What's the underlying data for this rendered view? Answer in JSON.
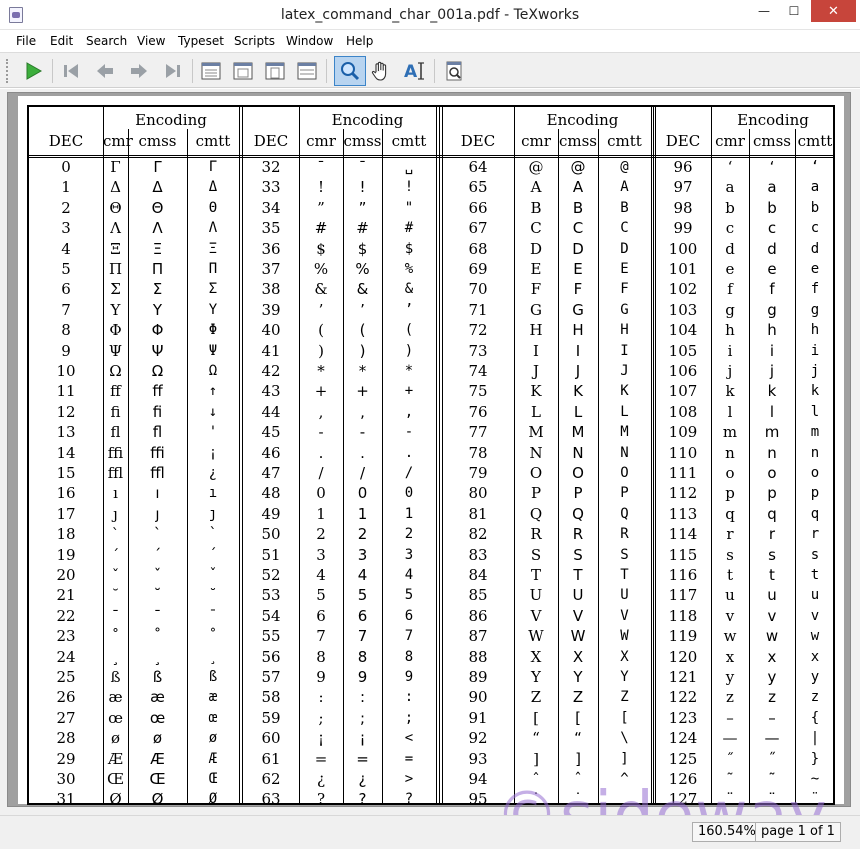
{
  "window": {
    "title": "latex_command_char_001a.pdf - TeXworks",
    "min_symbol": "—",
    "max_symbol": "☐",
    "close_symbol": "✕"
  },
  "menu": [
    "File",
    "Edit",
    "Search",
    "View",
    "Typeset",
    "Scripts",
    "Window",
    "Help"
  ],
  "toolbar": {
    "buttons": [
      {
        "name": "typeset-button",
        "icon": "play-icon"
      },
      {
        "name": "first-page-button",
        "icon": "first-page-icon"
      },
      {
        "name": "prev-page-button",
        "icon": "left-arrow-icon"
      },
      {
        "name": "next-page-button",
        "icon": "right-arrow-icon"
      },
      {
        "name": "last-page-button",
        "icon": "last-page-icon"
      },
      {
        "name": "actual-size-button",
        "icon": "page-icon"
      },
      {
        "name": "fit-width-button",
        "icon": "page-icon"
      },
      {
        "name": "fit-page-button",
        "icon": "page-icon"
      },
      {
        "name": "fit-window-button",
        "icon": "page-icon"
      },
      {
        "name": "magnify-tool-button",
        "icon": "magnifier-icon"
      },
      {
        "name": "scroll-tool-button",
        "icon": "hand-icon"
      },
      {
        "name": "select-text-tool-button",
        "icon": "text-select-icon"
      },
      {
        "name": "goto-source-button",
        "icon": "source-icon"
      }
    ]
  },
  "table": {
    "group_header": "Encoding",
    "dec_header": "DEC",
    "sub_headers": [
      "cmr",
      "cmss",
      "cmtt"
    ],
    "blocks": [
      {
        "dec_start": 0,
        "cmr": [
          "Γ",
          "Δ",
          "Θ",
          "Λ",
          "Ξ",
          "Π",
          "Σ",
          "Υ",
          "Φ",
          "Ψ",
          "Ω",
          "ﬀ",
          "ﬁ",
          "ﬂ",
          "ﬃ",
          "ﬄ",
          "ı",
          "ȷ",
          "`",
          "´",
          "ˇ",
          "˘",
          "¯",
          "˚",
          "¸",
          "ß",
          "æ",
          "œ",
          "ø",
          "Æ",
          "Œ",
          "Ø"
        ],
        "cmss": [
          "Γ",
          "Δ",
          "Θ",
          "Λ",
          "Ξ",
          "Π",
          "Σ",
          "Υ",
          "Φ",
          "Ψ",
          "Ω",
          "ﬀ",
          "ﬁ",
          "ﬂ",
          "ﬃ",
          "ﬄ",
          "ı",
          "ȷ",
          "`",
          "´",
          "ˇ",
          "˘",
          "¯",
          "˚",
          "¸",
          "ß",
          "æ",
          "œ",
          "ø",
          "Æ",
          "Œ",
          "Ø"
        ],
        "cmtt": [
          "Γ",
          "Δ",
          "Θ",
          "Λ",
          "Ξ",
          "Π",
          "Σ",
          "Υ",
          "Φ",
          "Ψ",
          "Ω",
          "↑",
          "↓",
          "'",
          "¡",
          "¿",
          "ı",
          "ȷ",
          "`",
          "´",
          "ˇ",
          "˘",
          "¯",
          "˚",
          "¸",
          "ß",
          "æ",
          "œ",
          "ø",
          "Æ",
          "Œ",
          "Ø"
        ]
      },
      {
        "dec_start": 32,
        "cmr": [
          "ˉ",
          "!",
          "”",
          "#",
          "$",
          "%",
          "&",
          "’",
          "(",
          ")",
          "*",
          "+",
          ",",
          "-",
          ".",
          "/",
          "0",
          "1",
          "2",
          "3",
          "4",
          "5",
          "6",
          "7",
          "8",
          "9",
          ":",
          ";",
          "¡",
          "=",
          "¿",
          "?"
        ],
        "cmss": [
          "ˉ",
          "!",
          "”",
          "#",
          "$",
          "%",
          "&",
          "’",
          "(",
          ")",
          "*",
          "+",
          ",",
          "-",
          ".",
          "/",
          "0",
          "1",
          "2",
          "3",
          "4",
          "5",
          "6",
          "7",
          "8",
          "9",
          ":",
          ";",
          "¡",
          "=",
          "¿",
          "?"
        ],
        "cmtt": [
          "␣",
          "!",
          "\"",
          "#",
          "$",
          "%",
          "&",
          "’",
          "(",
          ")",
          "*",
          "+",
          ",",
          "-",
          ".",
          "/",
          "0",
          "1",
          "2",
          "3",
          "4",
          "5",
          "6",
          "7",
          "8",
          "9",
          ":",
          ";",
          "<",
          "=",
          ">",
          "?"
        ]
      },
      {
        "dec_start": 64,
        "cmr": [
          "@",
          "A",
          "B",
          "C",
          "D",
          "E",
          "F",
          "G",
          "H",
          "I",
          "J",
          "K",
          "L",
          "M",
          "N",
          "O",
          "P",
          "Q",
          "R",
          "S",
          "T",
          "U",
          "V",
          "W",
          "X",
          "Y",
          "Z",
          "[",
          "“",
          "]",
          "ˆ",
          "˙"
        ],
        "cmss": [
          "@",
          "A",
          "B",
          "C",
          "D",
          "E",
          "F",
          "G",
          "H",
          "I",
          "J",
          "K",
          "L",
          "M",
          "N",
          "O",
          "P",
          "Q",
          "R",
          "S",
          "T",
          "U",
          "V",
          "W",
          "X",
          "Y",
          "Z",
          "[",
          "“",
          "]",
          "ˆ",
          "˙"
        ],
        "cmtt": [
          "@",
          "A",
          "B",
          "C",
          "D",
          "E",
          "F",
          "G",
          "H",
          "I",
          "J",
          "K",
          "L",
          "M",
          "N",
          "O",
          "P",
          "Q",
          "R",
          "S",
          "T",
          "U",
          "V",
          "W",
          "X",
          "Y",
          "Z",
          "[",
          "\\",
          "]",
          "^",
          "_"
        ]
      },
      {
        "dec_start": 96,
        "cmr": [
          "‘",
          "a",
          "b",
          "c",
          "d",
          "e",
          "f",
          "g",
          "h",
          "i",
          "j",
          "k",
          "l",
          "m",
          "n",
          "o",
          "p",
          "q",
          "r",
          "s",
          "t",
          "u",
          "v",
          "w",
          "x",
          "y",
          "z",
          "–",
          "—",
          "˝",
          "˜",
          "¨"
        ],
        "cmss": [
          "‘",
          "a",
          "b",
          "c",
          "d",
          "e",
          "f",
          "g",
          "h",
          "i",
          "j",
          "k",
          "l",
          "m",
          "n",
          "o",
          "p",
          "q",
          "r",
          "s",
          "t",
          "u",
          "v",
          "w",
          "x",
          "y",
          "z",
          "–",
          "—",
          "˝",
          "˜",
          "¨"
        ],
        "cmtt": [
          "‘",
          "a",
          "b",
          "c",
          "d",
          "e",
          "f",
          "g",
          "h",
          "i",
          "j",
          "k",
          "l",
          "m",
          "n",
          "o",
          "p",
          "q",
          "r",
          "s",
          "t",
          "u",
          "v",
          "w",
          "x",
          "y",
          "z",
          "{",
          "|",
          "}",
          "~",
          "¨"
        ]
      }
    ]
  },
  "watermark": "©sideway",
  "status": {
    "zoom": "160.54%",
    "page": "page 1 of 1"
  }
}
